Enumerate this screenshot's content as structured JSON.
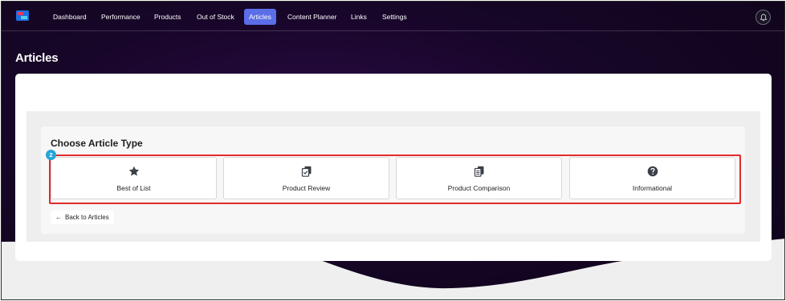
{
  "nav": {
    "items": [
      {
        "label": "Dashboard",
        "active": false
      },
      {
        "label": "Performance",
        "active": false
      },
      {
        "label": "Products",
        "active": false
      },
      {
        "label": "Out of Stock",
        "active": false
      },
      {
        "label": "Articles",
        "active": true
      },
      {
        "label": "Content Planner",
        "active": false
      },
      {
        "label": "Links",
        "active": false
      },
      {
        "label": "Settings",
        "active": false
      }
    ],
    "notification_icon": "bell-icon"
  },
  "page": {
    "title": "Articles"
  },
  "chooser": {
    "title": "Choose Article Type",
    "step_badge": "2",
    "types": [
      {
        "label": "Best of List",
        "icon": "star-icon"
      },
      {
        "label": "Product Review",
        "icon": "review-doc-icon"
      },
      {
        "label": "Product Comparison",
        "icon": "compare-docs-icon"
      },
      {
        "label": "Informational",
        "icon": "question-circle-icon"
      }
    ],
    "back_label": "Back to Articles"
  },
  "colors": {
    "accent": "#5b6ee8",
    "highlight": "#e32a2a",
    "badge": "#27a4d8",
    "background": "#170628"
  }
}
